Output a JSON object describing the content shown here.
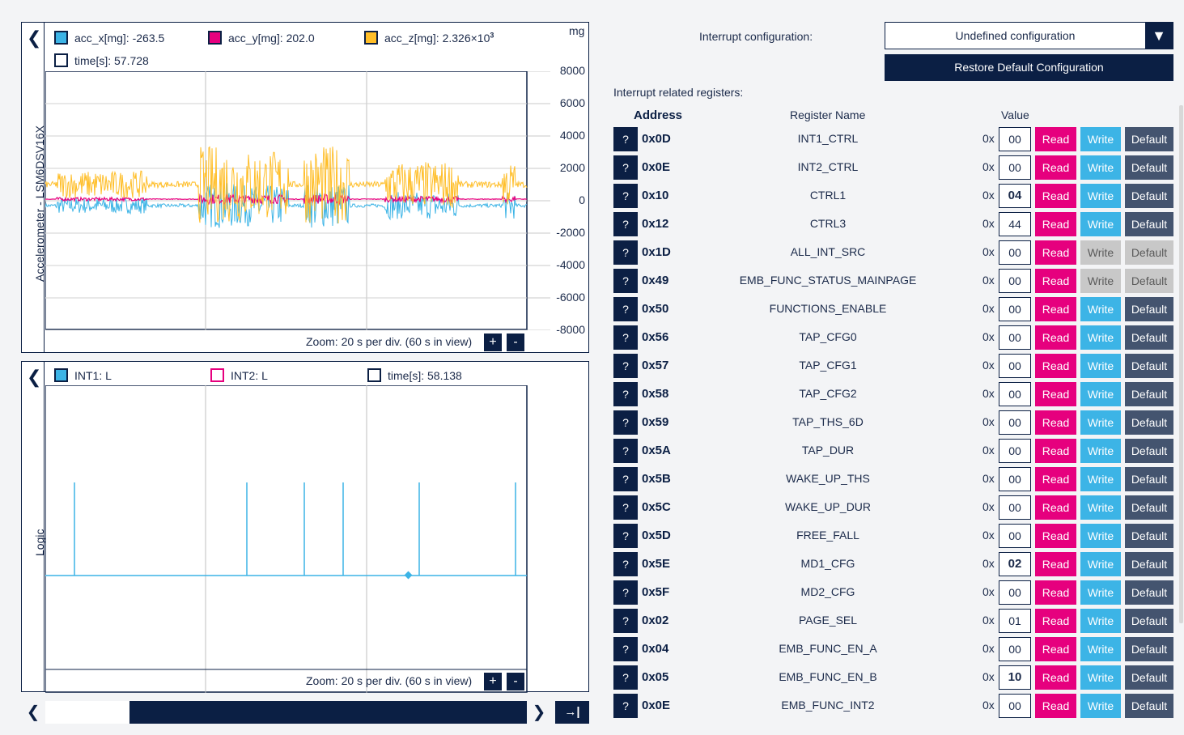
{
  "accel_panel": {
    "vertical_label": "Accelerometer - LSM6DSV16X",
    "unit": "mg",
    "legend": {
      "x_label": "acc_x[mg]: -263.5",
      "y_label": "acc_y[mg]: 202.0",
      "z_label_main": "acc_z[mg]: 2.326×10",
      "z_label_exp": "3",
      "time_label": "time[s]: 57.728"
    },
    "y_ticks": [
      "8000",
      "6000",
      "4000",
      "2000",
      "0",
      "-2000",
      "-4000",
      "-6000",
      "-8000"
    ],
    "zoom_text": "Zoom: 20 s per div. (60 s in view)",
    "zoom_plus": "+",
    "zoom_minus": "-",
    "colors": {
      "acc_x": "#3cb4e6",
      "acc_y": "#e6007e",
      "acc_z": "#ffbe28",
      "time": "#0b1f44"
    }
  },
  "logic_panel": {
    "vertical_label": "Logic",
    "legend": {
      "int1_label": "INT1: L",
      "int2_label": "INT2: L",
      "time_label": "time[s]: 58.138"
    },
    "zoom_text": "Zoom: 20 s per div. (60 s in view)",
    "zoom_plus": "+",
    "zoom_minus": "-"
  },
  "scroll_controls": {
    "left": "❮",
    "right": "❯",
    "end": "→|"
  },
  "config": {
    "interrupt_label": "Interrupt configuration:",
    "dropdown_value": "Undefined configuration",
    "restore_label": "Restore Default Configuration",
    "related_label": "Interrupt related registers:",
    "col_address": "Address",
    "col_name": "Register Name",
    "col_value": "Value"
  },
  "buttons": {
    "q": "?",
    "hex_prefix": "0x",
    "read": "Read",
    "write": "Write",
    "default": "Default"
  },
  "registers": [
    {
      "address": "0x0D",
      "name": "INT1_CTRL",
      "value": "00",
      "bold": false,
      "ro": false
    },
    {
      "address": "0x0E",
      "name": "INT2_CTRL",
      "value": "00",
      "bold": false,
      "ro": false
    },
    {
      "address": "0x10",
      "name": "CTRL1",
      "value": "04",
      "bold": true,
      "ro": false
    },
    {
      "address": "0x12",
      "name": "CTRL3",
      "value": "44",
      "bold": false,
      "ro": false
    },
    {
      "address": "0x1D",
      "name": "ALL_INT_SRC",
      "value": "00",
      "bold": false,
      "ro": true
    },
    {
      "address": "0x49",
      "name": "EMB_FUNC_STATUS_MAINPAGE",
      "value": "00",
      "bold": false,
      "ro": true
    },
    {
      "address": "0x50",
      "name": "FUNCTIONS_ENABLE",
      "value": "00",
      "bold": false,
      "ro": false
    },
    {
      "address": "0x56",
      "name": "TAP_CFG0",
      "value": "00",
      "bold": false,
      "ro": false
    },
    {
      "address": "0x57",
      "name": "TAP_CFG1",
      "value": "00",
      "bold": false,
      "ro": false
    },
    {
      "address": "0x58",
      "name": "TAP_CFG2",
      "value": "00",
      "bold": false,
      "ro": false
    },
    {
      "address": "0x59",
      "name": "TAP_THS_6D",
      "value": "00",
      "bold": false,
      "ro": false
    },
    {
      "address": "0x5A",
      "name": "TAP_DUR",
      "value": "00",
      "bold": false,
      "ro": false
    },
    {
      "address": "0x5B",
      "name": "WAKE_UP_THS",
      "value": "00",
      "bold": false,
      "ro": false
    },
    {
      "address": "0x5C",
      "name": "WAKE_UP_DUR",
      "value": "00",
      "bold": false,
      "ro": false
    },
    {
      "address": "0x5D",
      "name": "FREE_FALL",
      "value": "00",
      "bold": false,
      "ro": false
    },
    {
      "address": "0x5E",
      "name": "MD1_CFG",
      "value": "02",
      "bold": true,
      "ro": false
    },
    {
      "address": "0x5F",
      "name": "MD2_CFG",
      "value": "00",
      "bold": false,
      "ro": false
    },
    {
      "address": "0x02",
      "name": "PAGE_SEL",
      "value": "01",
      "bold": false,
      "ro": false
    },
    {
      "address": "0x04",
      "name": "EMB_FUNC_EN_A",
      "value": "00",
      "bold": false,
      "ro": false
    },
    {
      "address": "0x05",
      "name": "EMB_FUNC_EN_B",
      "value": "10",
      "bold": true,
      "ro": false
    },
    {
      "address": "0x0E",
      "name": "EMB_FUNC_INT2",
      "value": "00",
      "bold": false,
      "ro": false
    }
  ]
}
